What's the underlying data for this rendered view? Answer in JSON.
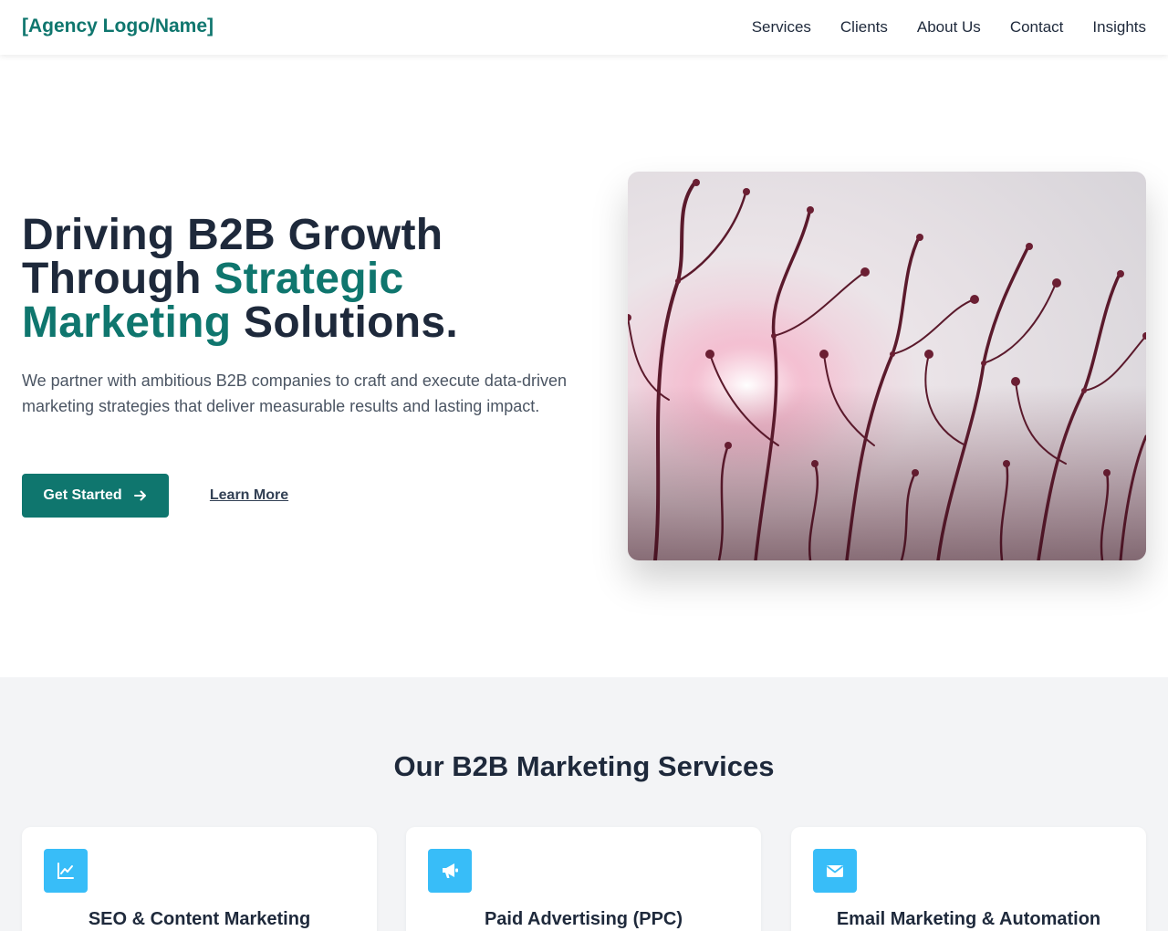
{
  "header": {
    "logo": "[Agency Logo/Name]",
    "nav": [
      "Services",
      "Clients",
      "About Us",
      "Contact",
      "Insights"
    ]
  },
  "hero": {
    "title_part1": "Driving B2B Growth Through ",
    "title_accent": "Strategic Marketing",
    "title_part2": " Solutions.",
    "description": "We partner with ambitious B2B companies to craft and execute data-driven marketing strategies that deliver measurable results and lasting impact.",
    "primary_button": "Get Started",
    "secondary_button": "Learn More"
  },
  "services": {
    "title": "Our B2B Marketing Services",
    "items": [
      {
        "title": "SEO & Content Marketing",
        "icon": "chart-line-icon"
      },
      {
        "title": "Paid Advertising (PPC)",
        "icon": "megaphone-icon"
      },
      {
        "title": "Email Marketing & Automation",
        "icon": "envelope-icon"
      }
    ]
  },
  "colors": {
    "brand": "#0f766e",
    "icon_bg": "#38bdf8",
    "heading": "#1e293b"
  }
}
